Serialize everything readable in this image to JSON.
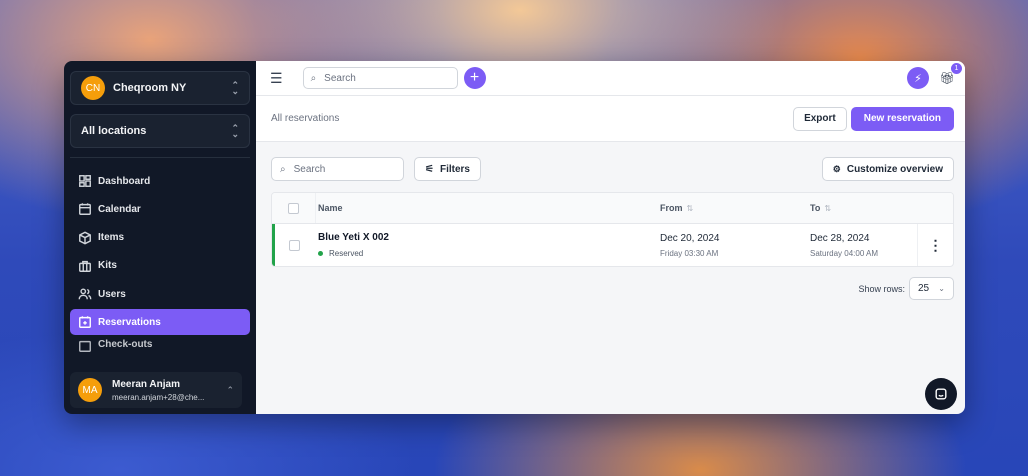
{
  "sidebar": {
    "workspace": {
      "initials": "CN",
      "name": "Cheqroom NY"
    },
    "location": {
      "label": "All locations"
    },
    "items": [
      {
        "label": "Dashboard",
        "icon": "dashboard-icon"
      },
      {
        "label": "Calendar",
        "icon": "calendar-icon"
      },
      {
        "label": "Items",
        "icon": "box-icon"
      },
      {
        "label": "Kits",
        "icon": "kit-icon"
      },
      {
        "label": "Users",
        "icon": "users-icon"
      },
      {
        "label": "Reservations",
        "icon": "reservation-icon",
        "active": true
      },
      {
        "label": "Check-outs",
        "icon": "checkout-icon"
      }
    ],
    "user": {
      "initials": "MA",
      "name": "Meeran Anjam",
      "email": "meeran.anjam+28@che..."
    }
  },
  "topbar": {
    "search_placeholder": "Search",
    "notification_count": "1"
  },
  "header": {
    "title": "All reservations",
    "export_label": "Export",
    "new_label": "New reservation"
  },
  "toolbar": {
    "search_placeholder": "Search",
    "filters_label": "Filters",
    "customize_label": "Customize overview"
  },
  "table": {
    "columns": {
      "name": "Name",
      "from": "From",
      "to": "To"
    },
    "rows": [
      {
        "name": "Blue Yeti X 002",
        "status": "Reserved",
        "from_date": "Dec 20, 2024",
        "from_time": "Friday 03:30 AM",
        "to_date": "Dec 28, 2024",
        "to_time": "Saturday 04:00 AM"
      }
    ]
  },
  "pager": {
    "label": "Show rows:",
    "value": "25"
  },
  "colors": {
    "accent": "#7c5cf5",
    "sidebar_bg": "#111827",
    "status_green": "#22a34a"
  }
}
